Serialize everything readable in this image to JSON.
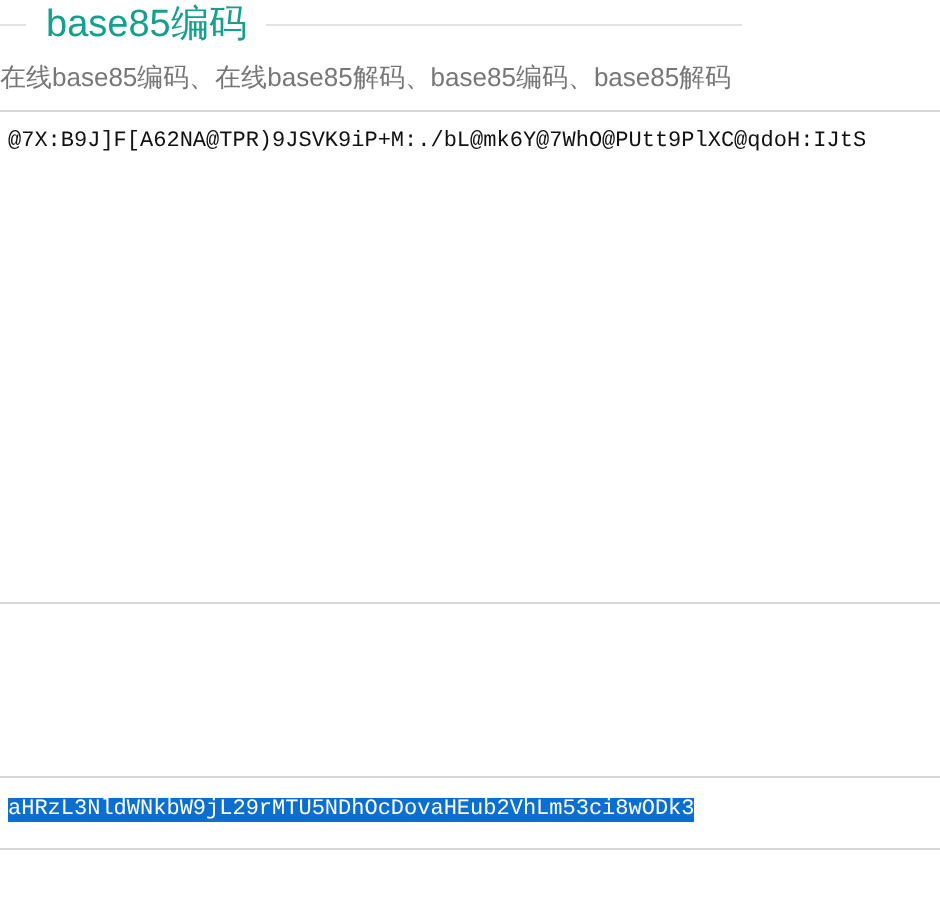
{
  "section": {
    "title": "base85编码",
    "subtitle": "在线base85编码、在线base85解码、base85编码、base85解码"
  },
  "input": {
    "value": "@7X:B9J]F[A62NA@TPR)9JSVK9iP+M:./bL@mk6Y@7WhO@PUtt9PlXC@qdoH:IJtS"
  },
  "output": {
    "value": "aHRzL3NldWNkbW9jL29rMTU5NDhOcDovaHEub2VhLm53ci8wODk3",
    "selected": true
  }
}
